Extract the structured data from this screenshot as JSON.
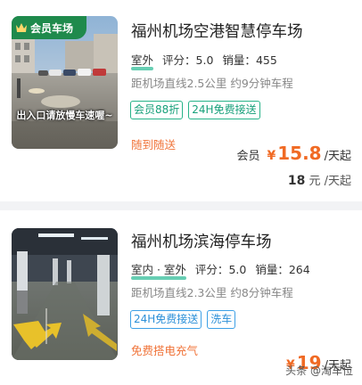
{
  "colors": {
    "accent": "#f06a24",
    "tag_green": "#17a07a",
    "tag_blue": "#2b8fd8",
    "member_green": "#1f8a4c"
  },
  "lots": [
    {
      "badge": "会员车场",
      "thumb_caption": "出入口请放慢车速喔~",
      "title": "福州机场空港智慧停车场",
      "location_type": "室外",
      "rating_label": "评分：",
      "rating": "5.0",
      "sales_label": "销量：",
      "sales": "455",
      "distance": "距机场直线2.5公里 约9分钟车程",
      "tags": [
        "会员88折",
        "24H免费接送"
      ],
      "promo": "随到随送",
      "member_label": "会员",
      "price_symbol": "¥",
      "price": "15.8",
      "price_unit": "/天起",
      "original_price": "18",
      "original_unit": "元 /天起"
    },
    {
      "title": "福州机场滨海停车场",
      "location_type": "室内 · 室外",
      "rating_label": "评分：",
      "rating": "5.0",
      "sales_label": "销量：",
      "sales": "264",
      "distance": "距机场直线2.3公里 约8分钟车程",
      "tags": [
        "24H免费接送",
        "洗车"
      ],
      "promo": "免费搭电充气",
      "price_symbol": "¥",
      "price": "19",
      "price_unit": "/天起"
    }
  ],
  "watermark": "头条 @淘车位"
}
